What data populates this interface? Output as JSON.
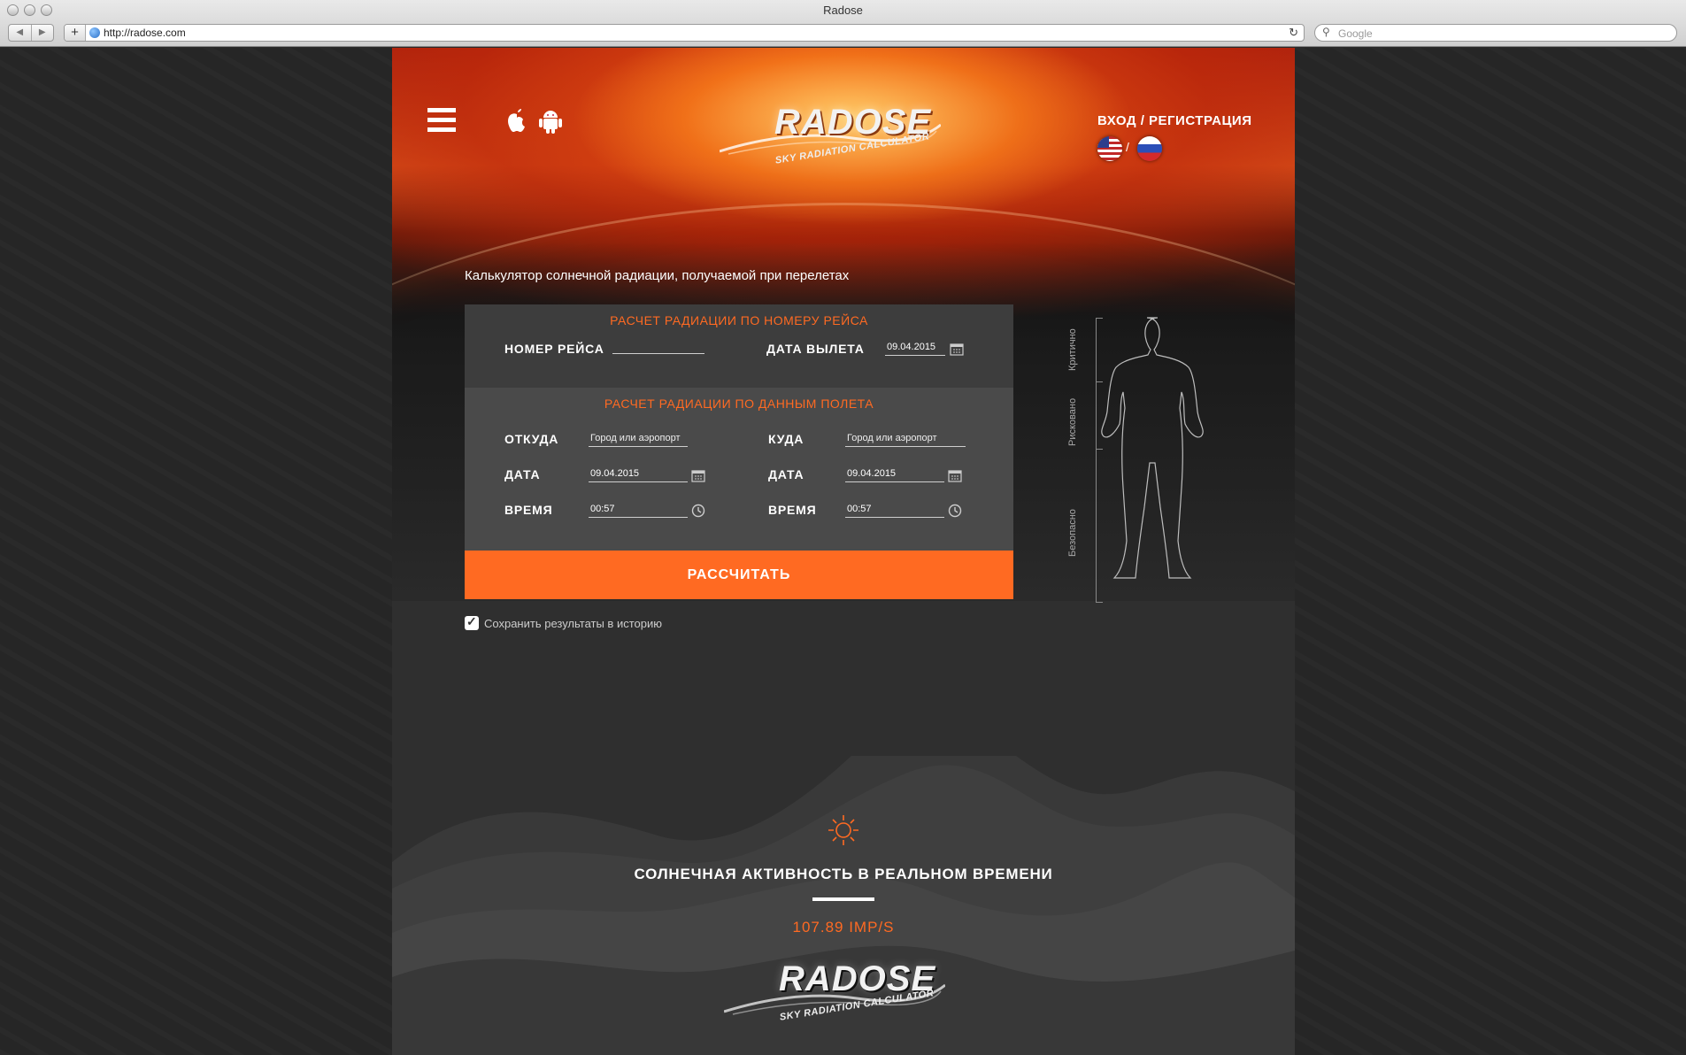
{
  "browser": {
    "window_title": "Radose",
    "url": "http://radose.com",
    "search_placeholder": "Google"
  },
  "header": {
    "logo_text": "RADOSE",
    "logo_subtitle": "SKY RADIATION CALCULATOR",
    "login_label": "ВХОД / РЕГИСТРАЦИЯ",
    "lang_separator": "/"
  },
  "intro": {
    "subtitle": "Калькулятор солнечной радиации, получаемой при перелетах"
  },
  "form": {
    "by_flight": {
      "title": "РАСЧЕТ РАДИАЦИИ ПО НОМЕРУ РЕЙСА",
      "flight_number_label": "НОМЕР РЕЙСА",
      "flight_number_value": "",
      "departure_date_label": "ДАТА ВЫЛЕТА",
      "departure_date_value": "09.04.2015"
    },
    "by_data": {
      "title": "РАСЧЕТ РАДИАЦИИ ПО ДАННЫМ ПОЛЕТА",
      "from_label": "ОТКУДА",
      "from_placeholder": "Город или аэропорт",
      "to_label": "КУДА",
      "to_placeholder": "Город или аэропорт",
      "date_from_label": "ДАТА",
      "date_from_value": "09.04.2015",
      "date_to_label": "ДАТА",
      "date_to_value": "09.04.2015",
      "time_from_label": "ВРЕМЯ",
      "time_from_value": "00:57",
      "time_to_label": "ВРЕМЯ",
      "time_to_value": "00:57"
    },
    "submit_label": "РАССЧИТАТЬ",
    "save_history_label": "Сохранить результаты в историю",
    "save_history_checked": true
  },
  "scale": {
    "levels": [
      "Критично",
      "Рисковано",
      "Безопасно"
    ]
  },
  "solar": {
    "title": "СОЛНЕЧНАЯ АКТИВНОСТЬ В РЕАЛЬНОМ ВРЕМЕНИ",
    "value": "107.89 IMP/S"
  },
  "footer": {
    "logo_text": "RADOSE",
    "logo_subtitle": "SKY RADIATION CALCULATOR"
  },
  "colors": {
    "accent": "#ff6a22",
    "panel_dark": "#3d3d3d",
    "panel_light": "#4a4a4a",
    "page_bg": "#262626"
  },
  "icons": {
    "menu": "hamburger-icon",
    "ios": "apple-icon",
    "android": "android-icon",
    "calendar": "calendar-icon",
    "clock": "clock-icon",
    "sun": "sun-icon",
    "checkbox": "checkmark-icon"
  }
}
